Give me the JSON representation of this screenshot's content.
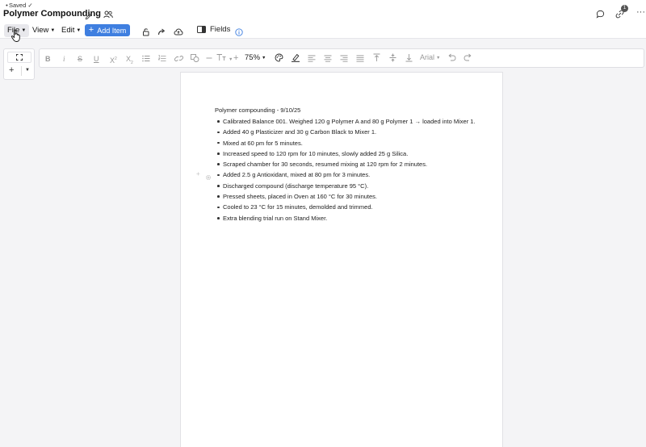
{
  "header": {
    "saved_label": "Saved",
    "saved_check": "✓",
    "title": "Polymer Compounding",
    "share_count": "1",
    "more": "···"
  },
  "menubar": {
    "file": "File",
    "view": "View",
    "edit": "Edit",
    "add_item": "Add Item",
    "fields": "Fields"
  },
  "toolbar": {
    "bold": "B",
    "italic": "i",
    "strike": "S",
    "underline": "U",
    "superscript": "X",
    "subscript": "X",
    "zoom": "75%",
    "font": "Arial"
  },
  "document": {
    "heading": "Polymer compounding - 9/10/25",
    "items": [
      "Calibrated Balance 001. Weighed 120 g Polymer A and 80 g Polymer 1 → loaded into Mixer 1.",
      "Added 40 g Plasticizer and 30 g Carbon Black to Mixer 1.",
      "Mixed at 60 pm for 5 minutes.",
      "Increased speed to 120 rpm for 10 minutes, slowly added 25 g Silica.",
      "Scraped chamber for 30 seconds, resumed mixing at 120 rpm for 2 minutes.",
      "Added 2.5 g Antioxidant, mixed at 80 pm for 3 minutes.",
      "Discharged compound (discharge temperature 95 °C).",
      "Pressed sheets, placed in Oven at 160 °C for 30 minutes.",
      "Cooled to 23 °C for 15 minutes, demolded and trimmed.",
      "Extra blending trial run on Stand Mixer."
    ]
  },
  "colors": {
    "accent": "#3f7fe0",
    "info": "#3f7fe0",
    "background": "#f4f4f6"
  }
}
